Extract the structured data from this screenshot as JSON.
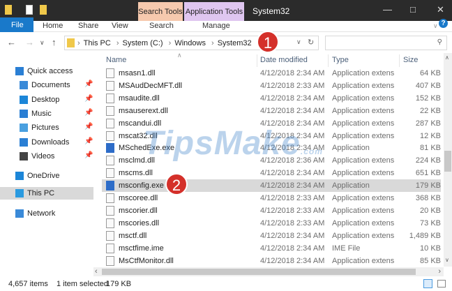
{
  "window": {
    "title": "System32",
    "contextual_tabs": [
      "Search Tools",
      "Application Tools"
    ]
  },
  "ribbon": {
    "file": "File",
    "tabs": [
      "Home",
      "Share",
      "View",
      "Search",
      "Manage"
    ],
    "help": "?"
  },
  "address": {
    "crumbs": [
      "This PC",
      "System (C:)",
      "Windows",
      "System32"
    ],
    "search_placeholder": ""
  },
  "columns": {
    "name": "Name",
    "date": "Date modified",
    "type": "Type",
    "size": "Size"
  },
  "sidebar": [
    {
      "label": "Quick access",
      "icon": "star-icon",
      "color": "#2a7fd4"
    },
    {
      "label": "Documents",
      "icon": "documents-icon",
      "pinned": true,
      "color": "#3a8ad8"
    },
    {
      "label": "Desktop",
      "icon": "desktop-icon",
      "pinned": true,
      "color": "#1c86d8"
    },
    {
      "label": "Music",
      "icon": "music-icon",
      "pinned": true,
      "color": "#2a7fd4"
    },
    {
      "label": "Pictures",
      "icon": "pictures-icon",
      "pinned": true,
      "color": "#4aa0e0"
    },
    {
      "label": "Downloads",
      "icon": "downloads-icon",
      "pinned": true,
      "color": "#2a7fd4"
    },
    {
      "label": "Videos",
      "icon": "videos-icon",
      "pinned": true,
      "color": "#444"
    },
    {
      "label": "OneDrive",
      "icon": "onedrive-icon",
      "color": "#1c86d8"
    },
    {
      "label": "This PC",
      "icon": "this-pc-icon",
      "selected": true,
      "color": "#2a9ae0"
    },
    {
      "label": "Network",
      "icon": "network-icon",
      "color": "#3a8ad8"
    }
  ],
  "files": [
    {
      "name": "msasn1.dll",
      "date": "4/12/2018 2:34 AM",
      "type": "Application extens",
      "size": "64 KB"
    },
    {
      "name": "MSAudDecMFT.dll",
      "date": "4/12/2018 2:33 AM",
      "type": "Application extens",
      "size": "407 KB"
    },
    {
      "name": "msaudite.dll",
      "date": "4/12/2018 2:34 AM",
      "type": "Application extens",
      "size": "152 KB"
    },
    {
      "name": "msauserext.dll",
      "date": "4/12/2018 2:34 AM",
      "type": "Application extens",
      "size": "22 KB"
    },
    {
      "name": "mscandui.dll",
      "date": "4/12/2018 2:34 AM",
      "type": "Application extens",
      "size": "287 KB"
    },
    {
      "name": "mscat32.dll",
      "date": "4/12/2018 2:34 AM",
      "type": "Application extens",
      "size": "12 KB"
    },
    {
      "name": "MSchedExe.exe",
      "date": "4/12/2018 2:34 AM",
      "type": "Application",
      "size": "81 KB",
      "exe": true
    },
    {
      "name": "msclmd.dll",
      "date": "4/12/2018 2:36 AM",
      "type": "Application extens",
      "size": "224 KB"
    },
    {
      "name": "mscms.dll",
      "date": "4/12/2018 2:34 AM",
      "type": "Application extens",
      "size": "651 KB"
    },
    {
      "name": "msconfig.exe",
      "date": "4/12/2018 2:34 AM",
      "type": "Application",
      "size": "179 KB",
      "exe": true,
      "selected": true
    },
    {
      "name": "mscoree.dll",
      "date": "4/12/2018 2:33 AM",
      "type": "Application extens",
      "size": "368 KB"
    },
    {
      "name": "mscorier.dll",
      "date": "4/12/2018 2:33 AM",
      "type": "Application extens",
      "size": "20 KB"
    },
    {
      "name": "mscories.dll",
      "date": "4/12/2018 2:33 AM",
      "type": "Application extens",
      "size": "73 KB"
    },
    {
      "name": "msctf.dll",
      "date": "4/12/2018 2:34 AM",
      "type": "Application extens",
      "size": "1,489 KB"
    },
    {
      "name": "msctfime.ime",
      "date": "4/12/2018 2:34 AM",
      "type": "IME File",
      "size": "10 KB"
    },
    {
      "name": "MsCtfMonitor.dll",
      "date": "4/12/2018 2:34 AM",
      "type": "Application extens",
      "size": "85 KB"
    }
  ],
  "status": {
    "count": "4,657 items",
    "selection": "1 item selected",
    "size": "179 KB"
  },
  "annotations": [
    "1",
    "2"
  ],
  "watermark": "TipsMake",
  "watermark_suffix": ".com",
  "colors": {
    "accent": "#1979ca",
    "badge": "#d4302a",
    "search_tools": "#f6c9ae",
    "app_tools": "#dfc6f0"
  }
}
